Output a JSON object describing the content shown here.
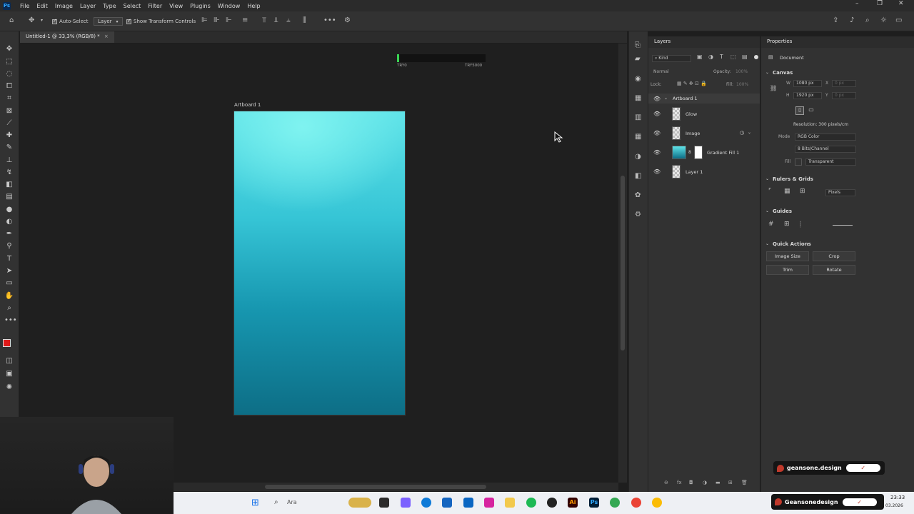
{
  "menu": [
    "File",
    "Edit",
    "Image",
    "Layer",
    "Type",
    "Select",
    "Filter",
    "View",
    "Plugins",
    "Window",
    "Help"
  ],
  "options": {
    "auto_select_label": "Auto-Select",
    "auto_select_target": "Layer",
    "show_transform_label": "Show Transform Controls"
  },
  "document": {
    "tab_title": "Untitled-1 @ 33,3% (RGB/8) *",
    "close": "×"
  },
  "artboard": {
    "label": "Artboard 1"
  },
  "overlay": {
    "start_label": "TRY0",
    "end_label": "TRY5000"
  },
  "layers_panel": {
    "title": "Layers",
    "filter": "Kind",
    "blend_mode": "Normal",
    "opacity_label": "Opacity:",
    "opacity_value": "100%",
    "lock_label": "Lock:",
    "fill_label": "Fill:",
    "fill_value": "100%",
    "group": "Artboard 1",
    "layers": [
      {
        "name": "Glow"
      },
      {
        "name": "Image"
      },
      {
        "name": "Gradient Fill 1"
      },
      {
        "name": "Layer 1"
      }
    ]
  },
  "properties_panel": {
    "title": "Properties",
    "doc_label": "Document",
    "canvas_title": "Canvas",
    "w_label": "W",
    "w_value": "1080 px",
    "h_label": "H",
    "h_value": "1920 px",
    "x_label": "X",
    "x_value": "0 px",
    "y_label": "Y",
    "y_value": "0 px",
    "resolution": "Resolution: 300 pixels/cm",
    "mode_label": "Mode",
    "mode_value": "RGB Color",
    "depth_value": "8 Bits/Channel",
    "fill_label": "Fill",
    "fill_value": "Transparent",
    "rulers_title": "Rulers & Grids",
    "units_value": "Pixels",
    "guides_title": "Guides",
    "quick_actions_title": "Quick Actions",
    "qa": [
      "Image Size",
      "Crop",
      "Trim",
      "Rotate"
    ]
  },
  "watermark": {
    "handle_small": "geansone.design",
    "handle_large": "Geansonedesign"
  },
  "taskbar": {
    "search": "Ara",
    "time": "23:33",
    "date": "03.2026"
  },
  "colors": {
    "foreground": "#e01a1a",
    "background": "#1a1a1a",
    "accent": "#31a8ff"
  }
}
